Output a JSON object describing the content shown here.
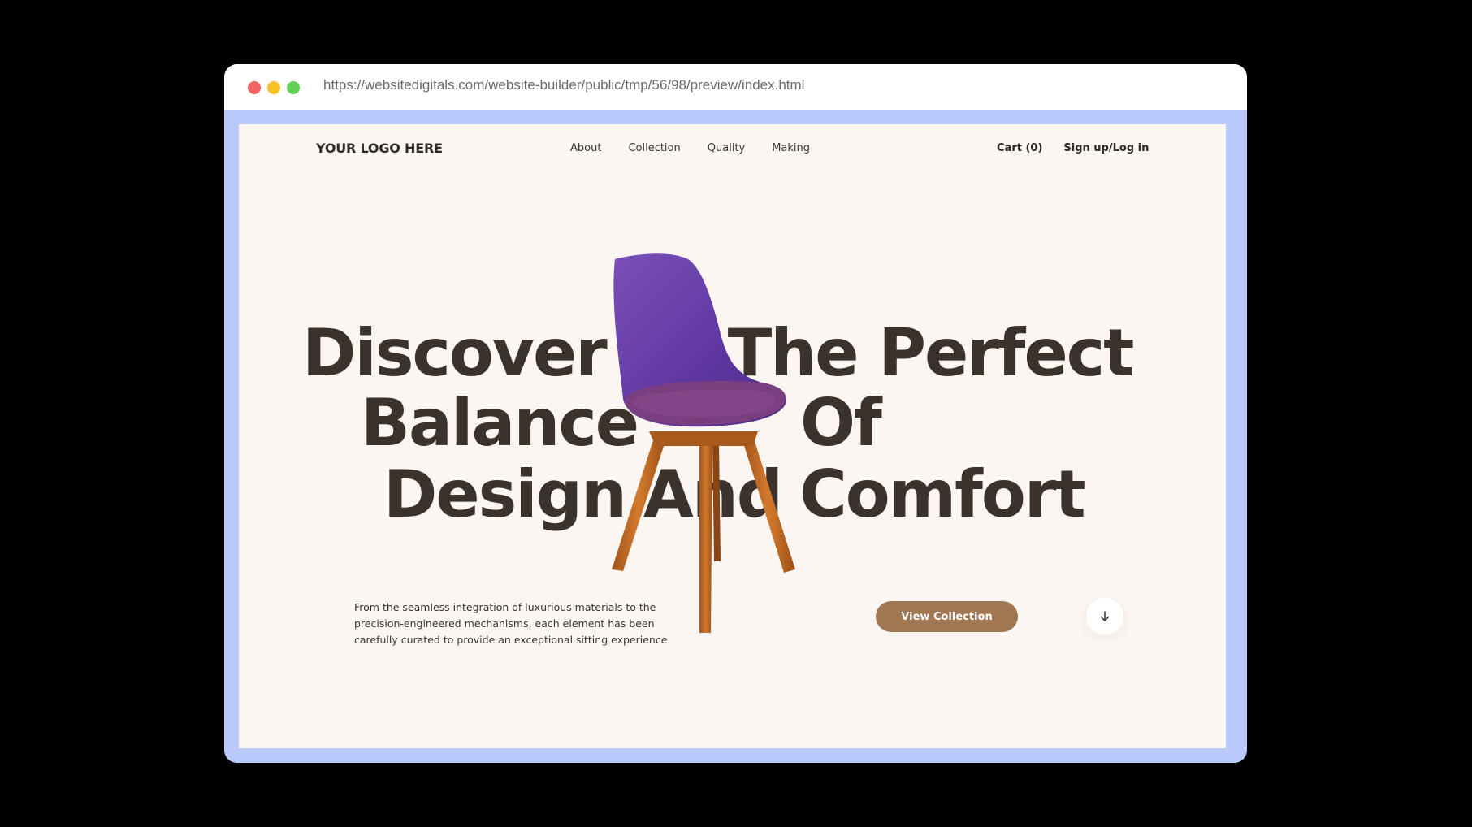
{
  "browser": {
    "url": "https://websitedigitals.com/website-builder/public/tmp/56/98/preview/index.html"
  },
  "nav": {
    "logo": "YOUR LOGO HERE",
    "links": [
      "About",
      "Collection",
      "Quality",
      "Making"
    ],
    "cart": "Cart (0)",
    "signin": "Sign up/Log in"
  },
  "hero": {
    "line1_left": "Discover",
    "line1_right": "The Perfect",
    "line2_left": "Balance",
    "line2_right": "Of",
    "line3_left": "Design",
    "line3_mid": "And",
    "line3_right": "Comfort",
    "description": "From the seamless integration of luxurious materials to the precision-engineered mechanisms, each element has been carefully curated to provide an exceptional sitting experience.",
    "cta": "View Collection",
    "scroll_icon": "arrow-down-icon"
  },
  "colors": {
    "page_bg": "#fbf6f1",
    "frame": "#b9c9fb",
    "heading": "#3a322b",
    "button": "#a07653",
    "chair_seat": "#6a3fa3",
    "chair_legs": "#c06a22"
  }
}
